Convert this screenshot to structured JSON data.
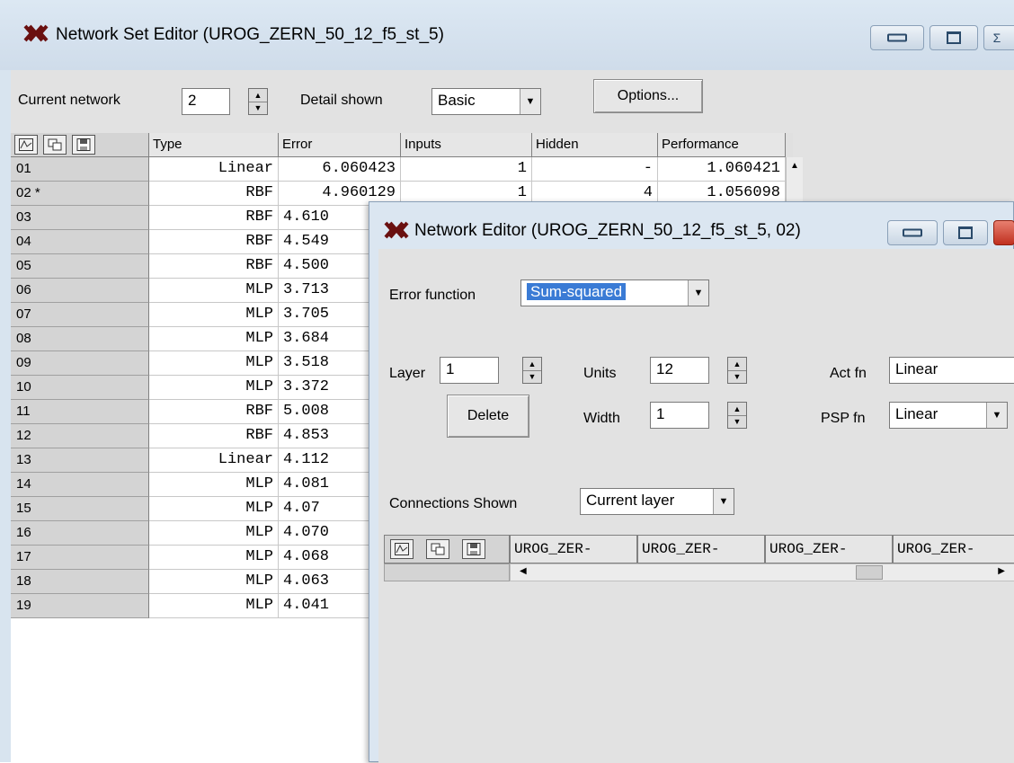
{
  "set_editor": {
    "title": "Network Set Editor (UROG_ZERN_50_12_f5_st_5)",
    "current_network_label": "Current network",
    "current_network_value": "2",
    "detail_shown_label": "Detail shown",
    "detail_shown_value": "Basic",
    "options_label": "Options...",
    "columns": [
      "Type",
      "Error",
      "Inputs",
      "Hidden",
      "Performance"
    ],
    "rows": [
      {
        "id": "01",
        "type": "Linear",
        "error": "6.060423",
        "inputs": "1",
        "hidden": "-",
        "performance": "1.060421"
      },
      {
        "id": "02 *",
        "type": "RBF",
        "error": "4.960129",
        "inputs": "1",
        "hidden": "4",
        "performance": "1.056098"
      },
      {
        "id": "03",
        "type": "RBF",
        "error": "4.610"
      },
      {
        "id": "04",
        "type": "RBF",
        "error": "4.549"
      },
      {
        "id": "05",
        "type": "RBF",
        "error": "4.500"
      },
      {
        "id": "06",
        "type": "MLP",
        "error": "3.713"
      },
      {
        "id": "07",
        "type": "MLP",
        "error": "3.705"
      },
      {
        "id": "08",
        "type": "MLP",
        "error": "3.684"
      },
      {
        "id": "09",
        "type": "MLP",
        "error": "3.518"
      },
      {
        "id": "10",
        "type": "MLP",
        "error": "3.372"
      },
      {
        "id": "11",
        "type": "RBF",
        "error": "5.008"
      },
      {
        "id": "12",
        "type": "RBF",
        "error": "4.853"
      },
      {
        "id": "13",
        "type": "Linear",
        "error": "4.112"
      },
      {
        "id": "14",
        "type": "MLP",
        "error": "4.081"
      },
      {
        "id": "15",
        "type": "MLP",
        "error": "4.07"
      },
      {
        "id": "16",
        "type": "MLP",
        "error": "4.070"
      },
      {
        "id": "17",
        "type": "MLP",
        "error": "4.068"
      },
      {
        "id": "18",
        "type": "MLP",
        "error": "4.063"
      },
      {
        "id": "19",
        "type": "MLP",
        "error": "4.041"
      }
    ]
  },
  "network_editor": {
    "title": "Network Editor (UROG_ZERN_50_12_f5_st_5, 02)",
    "error_function_label": "Error function",
    "error_function_value": "Sum-squared",
    "layer_label": "Layer",
    "layer_value": "1",
    "units_label": "Units",
    "units_value": "12",
    "act_fn_label": "Act fn",
    "act_fn_value": "Linear",
    "delete_label": "Delete",
    "width_label": "Width",
    "width_value": "1",
    "psp_fn_label": "PSP fn",
    "psp_fn_value": "Linear",
    "connections_label": "Connections Shown",
    "connections_value": "Current layer",
    "conn_columns": [
      "UROG_ZER-",
      "UROG_ZER-",
      "UROG_ZER-",
      "UROG_ZER-"
    ]
  }
}
